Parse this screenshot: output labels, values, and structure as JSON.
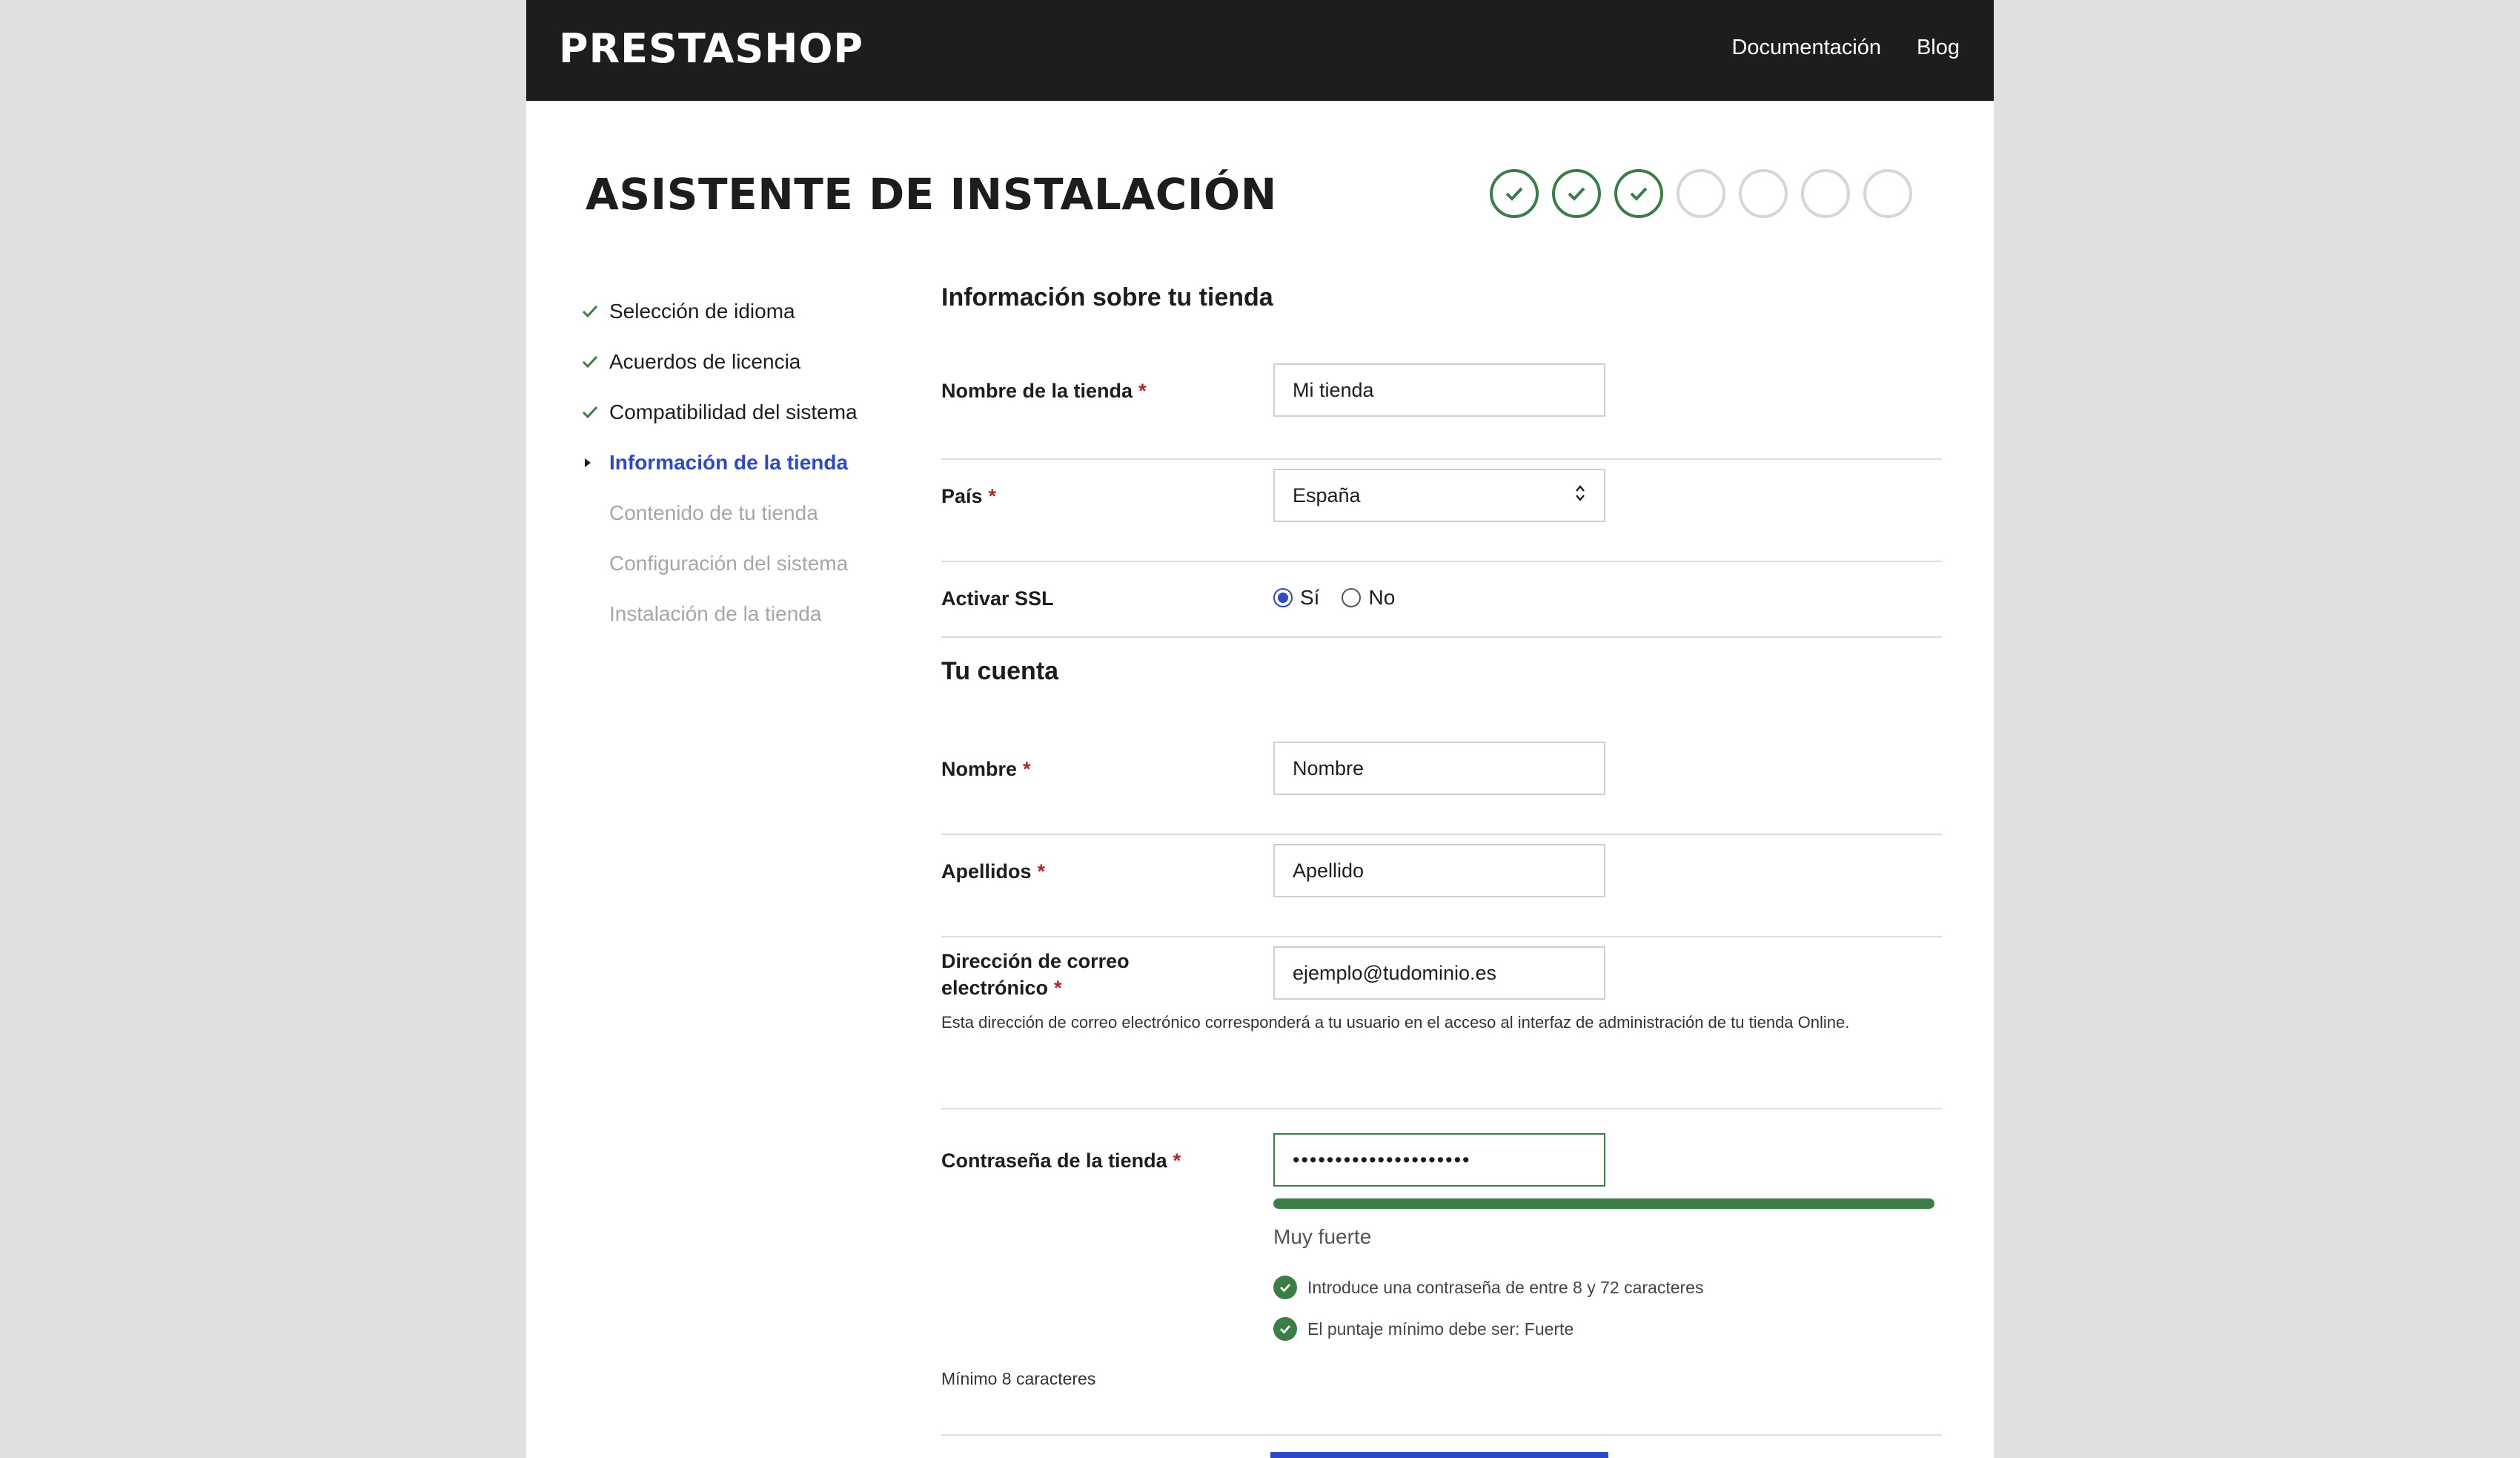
{
  "header": {
    "logo": "PRESTASHOP",
    "nav": [
      "Documentación",
      "Blog"
    ]
  },
  "wizard": {
    "title": "ASISTENTE DE INSTALACIÓN",
    "progress": {
      "completed_steps": 3,
      "total_steps": 7
    }
  },
  "sidebar": {
    "items": [
      {
        "label": "Selección de idioma",
        "state": "done"
      },
      {
        "label": "Acuerdos de licencia",
        "state": "done"
      },
      {
        "label": "Compatibilidad del sistema",
        "state": "done"
      },
      {
        "label": "Información de la tienda",
        "state": "active"
      },
      {
        "label": "Contenido de tu tienda",
        "state": "pending"
      },
      {
        "label": "Configuración del sistema",
        "state": "pending"
      },
      {
        "label": "Instalación de la tienda",
        "state": "pending"
      }
    ]
  },
  "store_section": {
    "title": "Información sobre tu tienda",
    "store_name": {
      "label": "Nombre de la tienda",
      "required_mark": "*",
      "value": "Mi tienda"
    },
    "country": {
      "label": "País",
      "required_mark": "*",
      "value": "España"
    },
    "ssl": {
      "label": "Activar SSL",
      "options": [
        "Sí",
        "No"
      ],
      "selected": "Sí"
    }
  },
  "account_section": {
    "title": "Tu cuenta",
    "first_name": {
      "label": "Nombre",
      "required_mark": "*",
      "value": "Nombre"
    },
    "last_name": {
      "label": "Apellidos",
      "required_mark": "*",
      "value": "Apellido"
    },
    "email": {
      "label_line1": "Dirección de correo",
      "label_line2": "electrónico",
      "required_mark": "*",
      "value": "ejemplo@tudominio.es",
      "help": "Esta dirección de correo electrónico corresponderá a tu usuario en el acceso al interfaz de administración de tu tienda Online."
    },
    "password": {
      "label": "Contraseña de la tienda",
      "required_mark": "*",
      "value": "•••••••••••••••••••••",
      "strength_label": "Muy fuerte",
      "strength_fraction": 1.0,
      "rules": [
        "Introduce una contraseña de entre 8 y 72 caracteres",
        "El puntaje mínimo debe ser: Fuerte"
      ],
      "min_hint": "Mínimo 8 caracteres"
    }
  },
  "colors": {
    "accent_blue": "#2d48c9",
    "success_green": "#3a7d46",
    "required_red": "#b3261e",
    "header_bg": "#1d1d1b"
  }
}
